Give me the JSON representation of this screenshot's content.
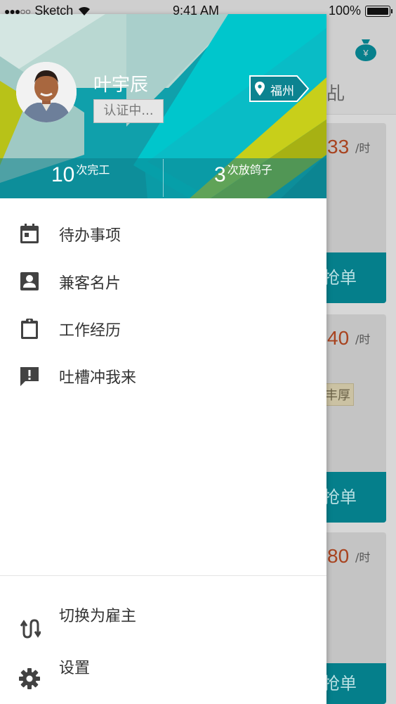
{
  "status_bar": {
    "carrier": "Sketch",
    "signal_dots": "●●●○○",
    "time": "9:41 AM",
    "battery_percent": 100,
    "battery_text": "100%"
  },
  "background": {
    "header_partial_char": "乩",
    "cards": [
      {
        "price": "33",
        "unit": "/时",
        "button": "抢单"
      },
      {
        "price": "40",
        "unit": "/时",
        "tag": "丰厚",
        "button": "抢单"
      },
      {
        "price": "80",
        "unit": "/时",
        "button": "抢单"
      }
    ]
  },
  "drawer": {
    "user": {
      "name": "叶宇辰",
      "verify_status": "认证中...",
      "city": "福州"
    },
    "stats": [
      {
        "value": "10",
        "label": "次完工"
      },
      {
        "value": "3",
        "label": "次放鸽子"
      }
    ],
    "menu": [
      {
        "icon": "calendar-icon",
        "label": "待办事项"
      },
      {
        "icon": "contact-card-icon",
        "label": "兼客名片"
      },
      {
        "icon": "clipboard-icon",
        "label": "工作经历"
      },
      {
        "icon": "feedback-icon",
        "label": "吐槽冲我来"
      }
    ],
    "footer_menu": [
      {
        "icon": "switch-icon",
        "label": "切换为雇主"
      },
      {
        "icon": "gear-icon",
        "label": "设置"
      }
    ]
  },
  "colors": {
    "header_teal": "#0f8c99",
    "accent_cyan": "#00c6cc",
    "accent_yellow": "#c8cf1a",
    "price_orange": "#c0511f"
  }
}
